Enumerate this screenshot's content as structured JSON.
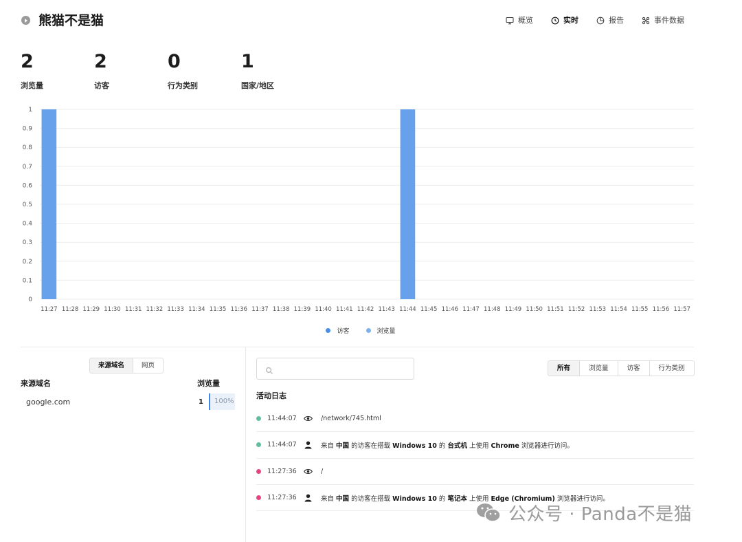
{
  "header": {
    "title": "熊猫不是猫",
    "nav": [
      {
        "label": "概览",
        "icon": "monitor-icon",
        "active": false
      },
      {
        "label": "实时",
        "icon": "clock-icon",
        "active": true
      },
      {
        "label": "报告",
        "icon": "pie-chart-icon",
        "active": false
      },
      {
        "label": "事件数据",
        "icon": "event-data-icon",
        "active": false
      }
    ]
  },
  "metrics": [
    {
      "value": "2",
      "label": "浏览量"
    },
    {
      "value": "2",
      "label": "访客"
    },
    {
      "value": "0",
      "label": "行为类别"
    },
    {
      "value": "1",
      "label": "国家/地区"
    }
  ],
  "chart_data": {
    "type": "bar",
    "categories": [
      "11:27",
      "11:28",
      "11:29",
      "11:30",
      "11:31",
      "11:32",
      "11:33",
      "11:34",
      "11:35",
      "11:36",
      "11:37",
      "11:38",
      "11:39",
      "11:40",
      "11:41",
      "11:42",
      "11:43",
      "11:44",
      "11:45",
      "11:46",
      "11:47",
      "11:48",
      "11:49",
      "11:50",
      "11:51",
      "11:52",
      "11:53",
      "11:54",
      "11:55",
      "11:56",
      "11:57"
    ],
    "series": [
      {
        "name": "访客",
        "color": "#4a8fe7",
        "values": [
          1,
          0,
          0,
          0,
          0,
          0,
          0,
          0,
          0,
          0,
          0,
          0,
          0,
          0,
          0,
          0,
          0,
          1,
          0,
          0,
          0,
          0,
          0,
          0,
          0,
          0,
          0,
          0,
          0,
          0,
          0
        ]
      },
      {
        "name": "浏览量",
        "color": "#7fb0ee",
        "values": [
          1,
          0,
          0,
          0,
          0,
          0,
          0,
          0,
          0,
          0,
          0,
          0,
          0,
          0,
          0,
          0,
          0,
          1,
          0,
          0,
          0,
          0,
          0,
          0,
          0,
          0,
          0,
          0,
          0,
          0,
          0
        ]
      }
    ],
    "yticks": [
      "0",
      "0.1",
      "0.2",
      "0.3",
      "0.4",
      "0.5",
      "0.6",
      "0.7",
      "0.8",
      "0.9",
      "1"
    ],
    "ylim": [
      0,
      1
    ],
    "grid": true,
    "legend_position": "bottom"
  },
  "referrers": {
    "tabs": [
      {
        "label": "来源域名",
        "active": true
      },
      {
        "label": "网页",
        "active": false
      }
    ],
    "col_domain": "来源域名",
    "col_views": "浏览量",
    "rows": [
      {
        "domain": "google.com",
        "count": "1",
        "percent": "100%"
      }
    ]
  },
  "activity": {
    "search_placeholder": "",
    "filters": [
      {
        "label": "所有",
        "active": true
      },
      {
        "label": "浏览量",
        "active": false
      },
      {
        "label": "访客",
        "active": false
      },
      {
        "label": "行为类别",
        "active": false
      }
    ],
    "title": "活动日志",
    "items": [
      {
        "time": "11:44:07",
        "dot_color": "#5fbfa0",
        "icon": "eye-icon",
        "parts": [
          {
            "t": "/network/745.html",
            "b": false
          }
        ]
      },
      {
        "time": "11:44:07",
        "dot_color": "#5fbfa0",
        "icon": "user-icon",
        "parts": [
          {
            "t": "来自 ",
            "b": false
          },
          {
            "t": "中国",
            "b": true
          },
          {
            "t": " 的访客在搭载 ",
            "b": false
          },
          {
            "t": "Windows 10",
            "b": true
          },
          {
            "t": " 的 ",
            "b": false
          },
          {
            "t": "台式机",
            "b": true
          },
          {
            "t": " 上使用 ",
            "b": false
          },
          {
            "t": "Chrome",
            "b": true
          },
          {
            "t": " 浏览器进行访问。",
            "b": false
          }
        ]
      },
      {
        "time": "11:27:36",
        "dot_color": "#e6457f",
        "icon": "eye-icon",
        "parts": [
          {
            "t": "/",
            "b": false
          }
        ]
      },
      {
        "time": "11:27:36",
        "dot_color": "#e6457f",
        "icon": "user-icon",
        "parts": [
          {
            "t": "来自 ",
            "b": false
          },
          {
            "t": "中国",
            "b": true
          },
          {
            "t": " 的访客在搭载 ",
            "b": false
          },
          {
            "t": "Windows 10",
            "b": true
          },
          {
            "t": " 的 ",
            "b": false
          },
          {
            "t": "笔记本",
            "b": true
          },
          {
            "t": " 上使用 ",
            "b": false
          },
          {
            "t": "Edge (Chromium)",
            "b": true
          },
          {
            "t": " 浏览器进行访问。",
            "b": false
          }
        ]
      }
    ]
  },
  "watermark": {
    "text": "公众号 · Panda不是猫",
    "icon": "wechat-icon"
  }
}
